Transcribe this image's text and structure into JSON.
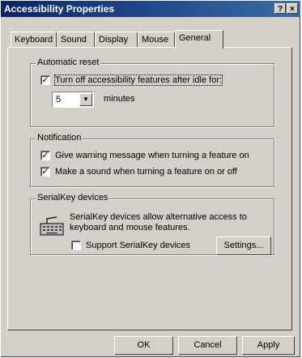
{
  "window": {
    "title": "Accessibility Properties",
    "help_glyph": "?",
    "close_glyph": "×"
  },
  "tabs": [
    {
      "label": "Keyboard"
    },
    {
      "label": "Sound"
    },
    {
      "label": "Display"
    },
    {
      "label": "Mouse"
    },
    {
      "label": "General",
      "active": true
    }
  ],
  "automatic_reset": {
    "legend": "Automatic reset",
    "checkbox_label": "Turn off accessibility features after idle for:",
    "checked": true,
    "minutes_value": "5",
    "minutes_label": "minutes"
  },
  "notification": {
    "legend": "Notification",
    "items": [
      {
        "label": "Give warning message when turning a feature on",
        "checked": true
      },
      {
        "label": "Make a sound when turning a feature on or off",
        "checked": true
      }
    ]
  },
  "serialkey": {
    "legend": "SerialKey devices",
    "description_line1": "SerialKey devices allow alternative access to",
    "description_line2": "keyboard and mouse features.",
    "checkbox_label": "Support SerialKey devices",
    "checked": false,
    "settings_label": "Settings..."
  },
  "footer": {
    "ok": "OK",
    "cancel": "Cancel",
    "apply": "Apply"
  },
  "icons": {
    "titlebar": [
      "help-icon",
      "close-icon"
    ],
    "serialkey": "keyboard-icon",
    "dropdown": "chevron-down-icon",
    "check": "check-icon"
  }
}
